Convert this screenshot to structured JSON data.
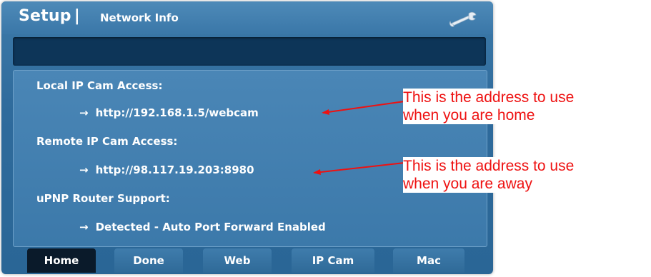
{
  "header": {
    "title": "Setup",
    "separator": "|",
    "subtitle": "Network Info",
    "icon": "wrench-icon"
  },
  "fields": {
    "local_label": "Local IP Cam Access:",
    "local_value": "http://192.168.1.5/webcam",
    "remote_label": "Remote IP Cam Access:",
    "remote_value": "http://98.117.19.203:8980",
    "upnp_label": "uPNP Router Support:",
    "upnp_value": "Detected - Auto Port Forward Enabled",
    "arrow": "→"
  },
  "tabs": [
    {
      "label": "Home",
      "active": true
    },
    {
      "label": "Done",
      "active": false
    },
    {
      "label": "Web",
      "active": false
    },
    {
      "label": "IP Cam",
      "active": false
    },
    {
      "label": "Mac",
      "active": false
    }
  ],
  "annotations": {
    "home_note_line1": "This is the address to use",
    "home_note_line2": "when you are home",
    "away_note_line1": "This is the address to use",
    "away_note_line2": "when you are away",
    "color": "#ee1111"
  },
  "colors": {
    "panel": "#2f6b9c",
    "dark_bar": "#0d3558",
    "active_tab": "#0a1a2a"
  }
}
